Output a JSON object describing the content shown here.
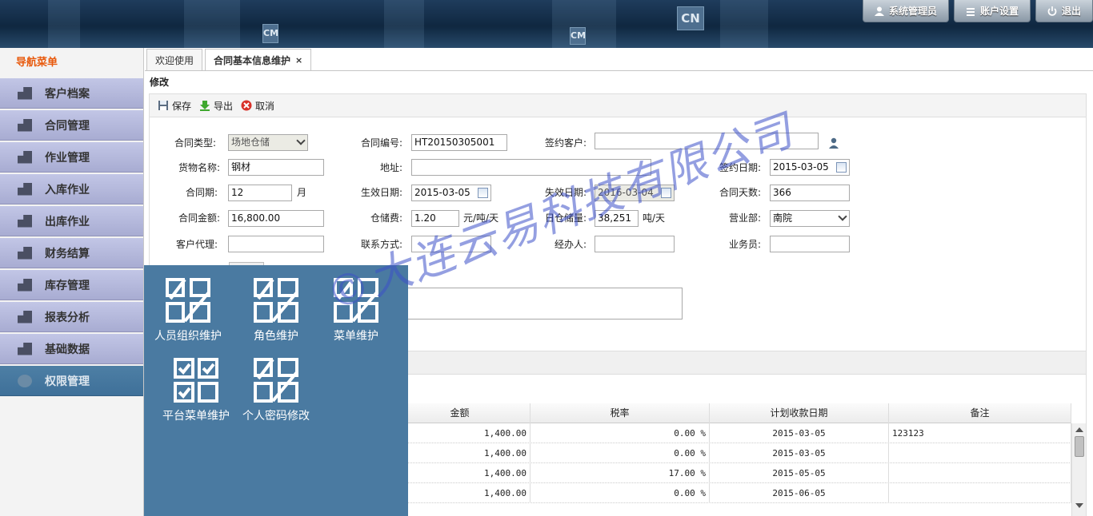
{
  "header": {
    "user_label": "系统管理员",
    "account_label": "账户设置",
    "logout_label": "退出",
    "container_marks": [
      "CN",
      "CM",
      "CM"
    ]
  },
  "sidebar": {
    "title": "导航菜单",
    "items": [
      {
        "label": "客户档案"
      },
      {
        "label": "合同管理"
      },
      {
        "label": "作业管理"
      },
      {
        "label": "入库作业"
      },
      {
        "label": "出库作业"
      },
      {
        "label": "财务结算"
      },
      {
        "label": "库存管理"
      },
      {
        "label": "报表分析"
      },
      {
        "label": "基础数据"
      },
      {
        "label": "权限管理"
      }
    ]
  },
  "popup": {
    "items": [
      {
        "label": "人员组织维护"
      },
      {
        "label": "角色维护"
      },
      {
        "label": "菜单维护"
      },
      {
        "label": "平台菜单维护"
      },
      {
        "label": "个人密码修改"
      }
    ]
  },
  "tabs": [
    {
      "label": "欢迎使用"
    },
    {
      "label": "合同基本信息维护",
      "close": "×"
    }
  ],
  "section_title": "修改",
  "toolbar": {
    "save": "保存",
    "export": "导出",
    "cancel": "取消"
  },
  "form": {
    "contract_type_label": "合同类型:",
    "contract_type_value": "场地仓储",
    "contract_no_label": "合同编号:",
    "contract_no_value": "HT20150305001",
    "customer_label": "签约客户:",
    "customer_value": "",
    "goods_label": "货物名称:",
    "goods_value": "钢材",
    "address_label": "地址:",
    "address_value": "",
    "sign_date_label": "签约日期:",
    "sign_date_value": "2015-03-05",
    "period_label": "合同期:",
    "period_value": "12",
    "period_unit": "月",
    "effective_label": "生效日期:",
    "effective_value": "2015-03-05",
    "expire_label": "失效日期:",
    "expire_value": "2016-03-04",
    "days_label": "合同天数:",
    "days_value": "366",
    "amount_label": "合同金额:",
    "amount_value": "16,800.00",
    "storage_fee_label": "仓储费:",
    "storage_fee_value": "1.20",
    "storage_fee_unit": "元/吨/天",
    "daily_label": "日仓储量:",
    "daily_value": "38,251",
    "daily_unit": "吨/天",
    "dept_label": "营业部:",
    "dept_value": "南院",
    "agent_label": "客户代理:",
    "agent_value": "",
    "contact_label": "联系方式:",
    "contact_value": "",
    "handler_label": "经办人:",
    "handler_value": "",
    "salesman_label": "业务员:",
    "salesman_value": ""
  },
  "grid": {
    "columns": [
      "金额",
      "税率",
      "计划收款日期",
      "备注"
    ],
    "rows": [
      {
        "amount": "1,400.00",
        "tax": "0.00 %",
        "date": "2015-03-05",
        "note": "123123"
      },
      {
        "amount": "1,400.00",
        "tax": "0.00 %",
        "date": "2015-03-05",
        "note": ""
      },
      {
        "amount": "1,400.00",
        "tax": "17.00 %",
        "date": "2015-05-05",
        "note": ""
      },
      {
        "amount": "1,400.00",
        "tax": "0.00 %",
        "date": "2015-06-05",
        "note": ""
      }
    ]
  },
  "watermark": "©大连云易科技有限公司",
  "colors": {
    "nav_title": "#e8590c",
    "nav_item": "#b5b9dd",
    "nav_active": "#4677a0",
    "popup_bg": "#4a7aa1",
    "watermark": "#3c50c8"
  }
}
